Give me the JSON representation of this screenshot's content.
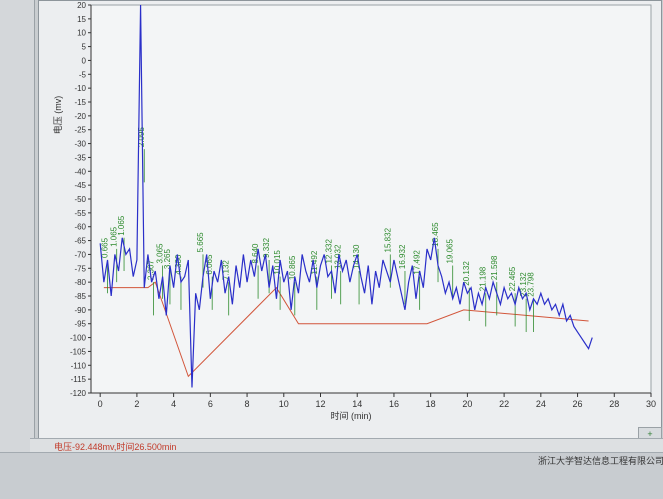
{
  "colors": {
    "signal": "#2a2fc9",
    "peak": "#2e8b2e",
    "baseline": "#d2553a",
    "status": "#c23b2a",
    "axis": "#333333"
  },
  "chart_data": {
    "type": "line",
    "xlabel": "时间 (min)",
    "ylabel": "电压 (mv)",
    "xlim": [
      -0.5,
      30
    ],
    "ylim": [
      -120,
      20
    ],
    "x_ticks": [
      0,
      2,
      4,
      6,
      8,
      10,
      12,
      14,
      16,
      18,
      20,
      22,
      24,
      26,
      28,
      30
    ],
    "y_ticks": [
      20,
      15,
      10,
      5,
      0,
      -5,
      -10,
      -15,
      -20,
      -25,
      -30,
      -35,
      -40,
      -45,
      -50,
      -55,
      -60,
      -65,
      -70,
      -75,
      -80,
      -85,
      -90,
      -95,
      -100,
      -105,
      -110,
      -115,
      -120
    ],
    "series": [
      {
        "x": [
          0,
          0.2,
          0.4,
          0.6,
          0.8,
          1.0,
          1.2,
          1.4,
          1.6,
          1.8,
          2.0,
          2.2,
          2.4,
          2.6,
          2.8,
          3.0,
          3.2,
          3.4,
          3.6,
          3.8,
          4.0,
          4.2,
          4.4,
          4.6,
          4.8,
          5.0,
          5.2,
          5.4,
          5.6,
          5.8,
          6.0,
          6.2,
          6.4,
          6.6,
          6.8,
          7.0,
          7.2,
          7.4,
          7.6,
          7.8,
          8.0,
          8.2,
          8.4,
          8.6,
          8.8,
          9.0,
          9.2,
          9.4,
          9.6,
          9.8,
          10.0,
          10.2,
          10.4,
          10.6,
          10.8,
          11.0,
          11.2,
          11.4,
          11.6,
          11.8,
          12.0,
          12.2,
          12.4,
          12.6,
          12.8,
          13.0,
          13.2,
          13.4,
          13.6,
          13.8,
          14.0,
          14.2,
          14.4,
          14.6,
          14.8,
          15.0,
          15.2,
          15.4,
          15.6,
          15.8,
          16.0,
          16.2,
          16.4,
          16.6,
          16.8,
          17.0,
          17.2,
          17.4,
          17.6,
          17.8,
          18.0,
          18.2,
          18.4,
          18.6,
          18.8,
          19.0,
          19.2,
          19.4,
          19.6,
          19.8,
          20.0,
          20.2,
          20.4,
          20.6,
          20.8,
          21.0,
          21.2,
          21.4,
          21.6,
          21.8,
          22.0,
          22.2,
          22.4,
          22.6,
          22.8,
          23.0,
          23.2,
          23.4,
          23.6,
          23.8,
          24.0,
          24.2,
          24.4,
          24.6,
          24.8,
          25.0,
          25.2,
          25.4,
          25.6,
          25.8,
          26.0,
          26.2,
          26.4,
          26.6,
          26.8
        ],
        "values": [
          -66,
          -80,
          -72,
          -85,
          -70,
          -76,
          -64,
          -70,
          -68,
          -78,
          -72,
          20,
          -82,
          -70,
          -80,
          -76,
          -86,
          -78,
          -92,
          -74,
          -82,
          -70,
          -80,
          -78,
          -72,
          -118,
          -84,
          -90,
          -78,
          -70,
          -86,
          -76,
          -80,
          -72,
          -84,
          -78,
          -88,
          -74,
          -82,
          -70,
          -80,
          -72,
          -78,
          -68,
          -76,
          -70,
          -82,
          -74,
          -86,
          -72,
          -80,
          -76,
          -90,
          -78,
          -84,
          -70,
          -76,
          -80,
          -72,
          -82,
          -74,
          -70,
          -78,
          -76,
          -84,
          -70,
          -76,
          -72,
          -80,
          -74,
          -70,
          -78,
          -84,
          -74,
          -88,
          -76,
          -82,
          -72,
          -76,
          -80,
          -72,
          -78,
          -84,
          -90,
          -80,
          -74,
          -86,
          -76,
          -82,
          -68,
          -72,
          -64,
          -74,
          -78,
          -84,
          -80,
          -86,
          -82,
          -88,
          -80,
          -84,
          -82,
          -90,
          -84,
          -88,
          -82,
          -86,
          -80,
          -84,
          -88,
          -82,
          -86,
          -84,
          -88,
          -82,
          -86,
          -84,
          -90,
          -86,
          -88,
          -84,
          -88,
          -86,
          -90,
          -88,
          -92,
          -88,
          -94,
          -92,
          -96,
          -98,
          -100,
          -102,
          -104,
          -100
        ]
      }
    ],
    "peak_labels": [
      {
        "x": 0.4,
        "y": -72,
        "text": "0.665"
      },
      {
        "x": 0.9,
        "y": -68,
        "text": "1.065"
      },
      {
        "x": 1.3,
        "y": -64,
        "text": "1.065"
      },
      {
        "x": 2.4,
        "y": -32,
        "text": "2.095"
      },
      {
        "x": 2.9,
        "y": -80,
        "text": "2.307"
      },
      {
        "x": 3.4,
        "y": -74,
        "text": "3.065"
      },
      {
        "x": 3.8,
        "y": -76,
        "text": "3.265"
      },
      {
        "x": 4.4,
        "y": -78,
        "text": "4.380"
      },
      {
        "x": 5.6,
        "y": -70,
        "text": "5.665"
      },
      {
        "x": 6.1,
        "y": -78,
        "text": "6.065"
      },
      {
        "x": 7.0,
        "y": -80,
        "text": "7.132"
      },
      {
        "x": 8.6,
        "y": -74,
        "text": "8.640"
      },
      {
        "x": 9.2,
        "y": -72,
        "text": "9.332"
      },
      {
        "x": 9.8,
        "y": -78,
        "text": "10.015"
      },
      {
        "x": 10.6,
        "y": -80,
        "text": "10.865"
      },
      {
        "x": 11.8,
        "y": -78,
        "text": "11.492"
      },
      {
        "x": 12.6,
        "y": -74,
        "text": "12.332"
      },
      {
        "x": 13.1,
        "y": -76,
        "text": "13.032"
      },
      {
        "x": 14.1,
        "y": -76,
        "text": "14.130"
      },
      {
        "x": 15.8,
        "y": -70,
        "text": "15.832"
      },
      {
        "x": 16.6,
        "y": -76,
        "text": "16.932"
      },
      {
        "x": 17.4,
        "y": -78,
        "text": "17.492"
      },
      {
        "x": 18.4,
        "y": -68,
        "text": "18.465"
      },
      {
        "x": 19.2,
        "y": -74,
        "text": "19.065"
      },
      {
        "x": 20.1,
        "y": -82,
        "text": "20.132"
      },
      {
        "x": 21.0,
        "y": -84,
        "text": "21.198"
      },
      {
        "x": 21.6,
        "y": -80,
        "text": "21.598"
      },
      {
        "x": 22.6,
        "y": -84,
        "text": "22.465"
      },
      {
        "x": 23.2,
        "y": -86,
        "text": "23.132"
      },
      {
        "x": 23.6,
        "y": -86,
        "text": "23.798"
      }
    ],
    "baseline": {
      "x": [
        0.2,
        2.6,
        3.0,
        4.8,
        9.6,
        10.8,
        17.8,
        19.8,
        26.6
      ],
      "values": [
        -82,
        -82,
        -80,
        -114,
        -82,
        -95,
        -95,
        -90,
        -94
      ]
    }
  },
  "status": {
    "text": "电压-92.448mv,时间26.500min"
  },
  "footer": {
    "company": "浙江大学智达信息工程有限公司"
  },
  "corner_button": {
    "icon": "arrow-icon",
    "label": "+"
  }
}
